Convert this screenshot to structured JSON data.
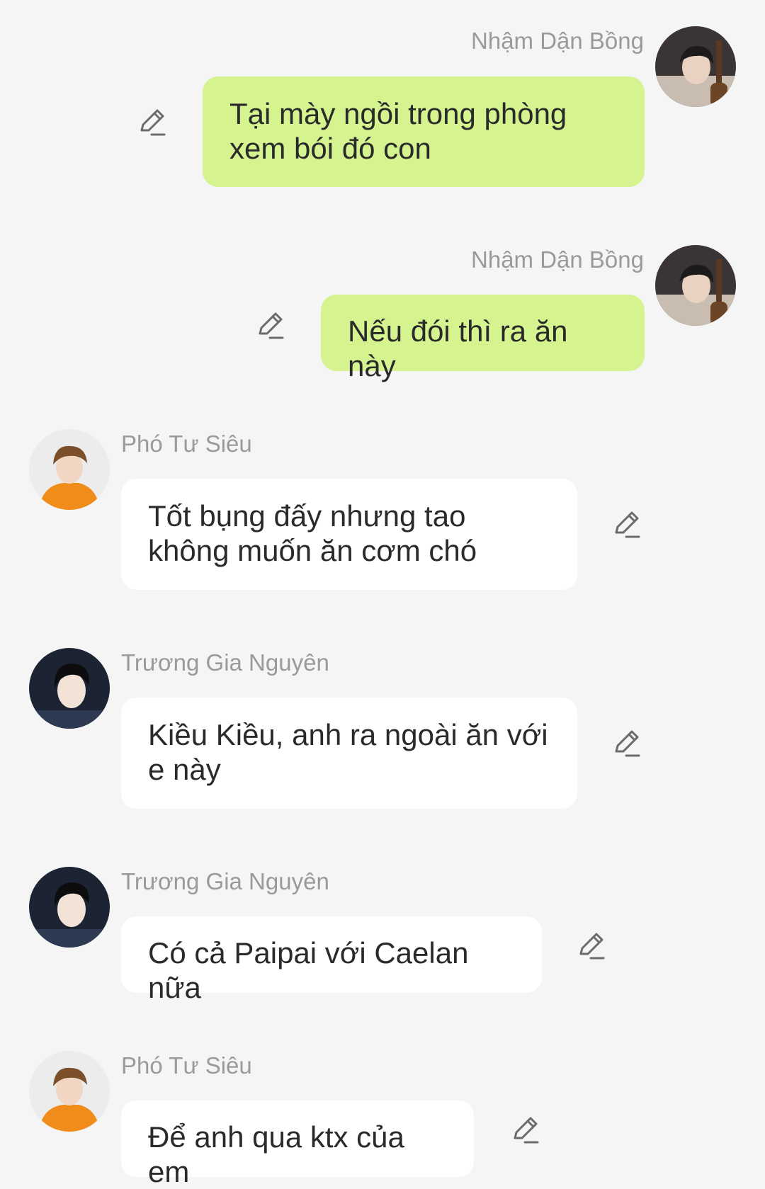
{
  "messages": [
    {
      "sender": "Nhậm Dận Bồng",
      "text": "Tại mày ngồi trong phòng xem bói đó con",
      "direction": "outgoing",
      "avatar": "avatar-dark-hair-cello"
    },
    {
      "sender": "Nhậm Dận Bồng",
      "text": "Nếu đói thì ra ăn này",
      "direction": "outgoing",
      "avatar": "avatar-dark-hair-cello"
    },
    {
      "sender": "Phó Tư Siêu",
      "text": "Tốt bụng đấy nhưng tao không muốn ăn cơm chó",
      "direction": "incoming",
      "avatar": "avatar-brown-hair-orange-jacket"
    },
    {
      "sender": "Trương Gia Nguyên",
      "text": "Kiều Kiều, anh ra ngoài ăn với e này",
      "direction": "incoming",
      "avatar": "avatar-black-hair-portrait"
    },
    {
      "sender": "Trương Gia Nguyên",
      "text": "Có cả Paipai với Caelan nữa",
      "direction": "incoming",
      "avatar": "avatar-black-hair-portrait"
    },
    {
      "sender": "Phó Tư Siêu",
      "text": "Để anh qua ktx của em",
      "direction": "incoming",
      "avatar": "avatar-brown-hair-orange-jacket"
    }
  ],
  "icons": {
    "edit": "pencil-edit-icon"
  },
  "colors": {
    "background": "#f5f5f5",
    "outgoing_bubble": "#d5f490",
    "incoming_bubble": "#ffffff",
    "sender_name": "#9a9a9a",
    "message_text": "#2a2a2a",
    "icon_stroke": "#6b6b6b"
  }
}
